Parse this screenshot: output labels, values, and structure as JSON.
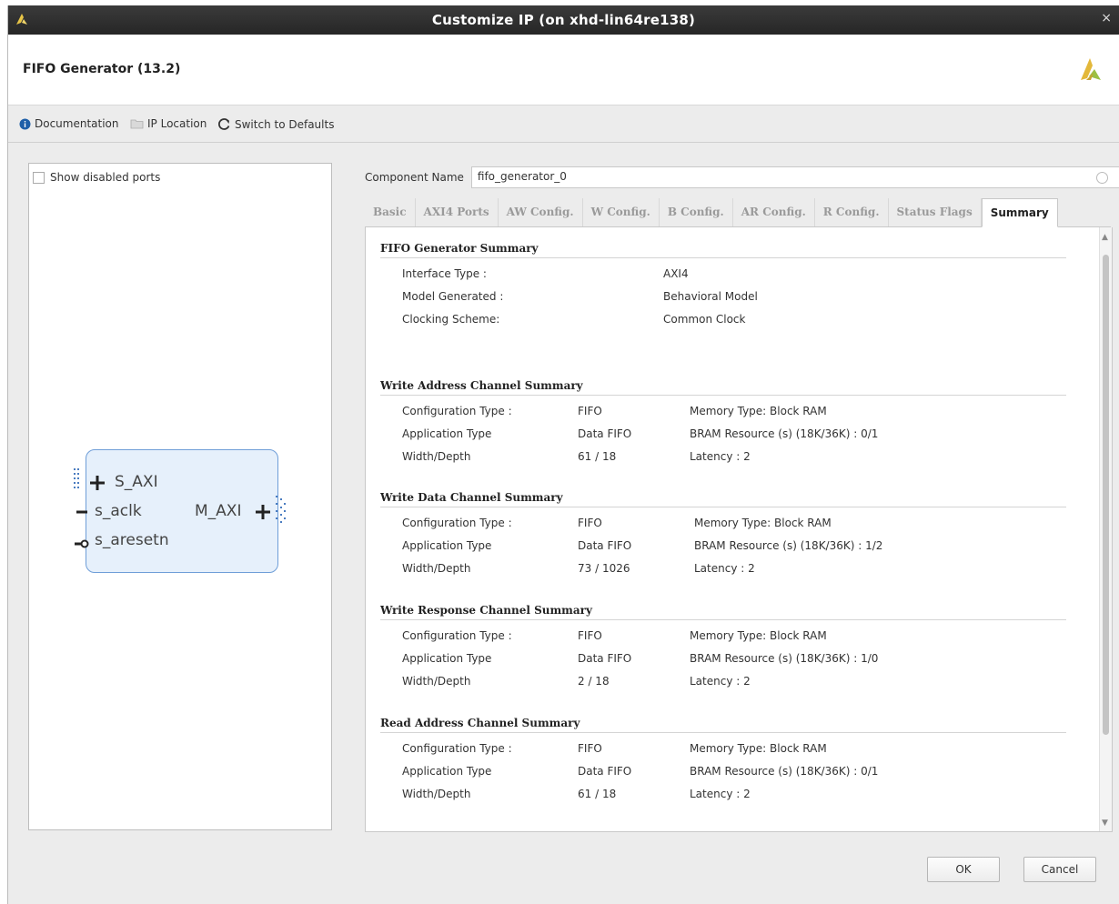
{
  "window": {
    "title": "Customize IP (on xhd-lin64re138)",
    "close_glyph": "×"
  },
  "header": {
    "ip_title": "FIFO Generator (13.2)"
  },
  "toolbar": {
    "documentation": "Documentation",
    "ip_location": "IP Location",
    "switch_defaults": "Switch to Defaults"
  },
  "left_panel": {
    "show_disabled_ports": "Show disabled ports",
    "symbol": {
      "ports_left": [
        "S_AXI",
        "s_aclk",
        "s_aresetn"
      ],
      "ports_right": [
        "M_AXI"
      ]
    }
  },
  "component": {
    "label": "Component Name",
    "value": "fifo_generator_0"
  },
  "tabs": [
    {
      "label": "Basic",
      "active": false
    },
    {
      "label": "AXI4 Ports",
      "active": false
    },
    {
      "label": "AW Config.",
      "active": false
    },
    {
      "label": "W Config.",
      "active": false
    },
    {
      "label": "B Config.",
      "active": false
    },
    {
      "label": "AR Config.",
      "active": false
    },
    {
      "label": "R Config.",
      "active": false
    },
    {
      "label": "Status Flags",
      "active": false
    },
    {
      "label": "Summary",
      "active": true
    }
  ],
  "summary": {
    "fifo_generator": {
      "title": "FIFO Generator Summary",
      "rows": [
        {
          "label": "Interface Type :",
          "value": "AXI4"
        },
        {
          "label": "Model Generated :",
          "value": "Behavioral Model"
        },
        {
          "label": "Clocking Scheme:",
          "value": "Common Clock"
        }
      ]
    },
    "channels": [
      {
        "title": "Write Address Channel Summary",
        "rows": [
          {
            "label": "Configuration Type :",
            "value": "FIFO",
            "info": "Memory Type: Block RAM"
          },
          {
            "label": "Application Type",
            "value": "Data FIFO",
            "info": "BRAM Resource (s) (18K/36K) : 0/1"
          },
          {
            "label": "Width/Depth",
            "value": "61 / 18",
            "info": "Latency : 2"
          }
        ]
      },
      {
        "title": "Write Data Channel Summary",
        "rows": [
          {
            "label": "Configuration Type :",
            "value": "FIFO",
            "info": "Memory Type: Block RAM"
          },
          {
            "label": "Application Type",
            "value": "Data FIFO",
            "info": "BRAM Resource (s) (18K/36K) : 1/2"
          },
          {
            "label": "Width/Depth",
            "value": "73 / 1026",
            "info": "Latency : 2"
          }
        ]
      },
      {
        "title": "Write Response Channel Summary",
        "rows": [
          {
            "label": "Configuration Type :",
            "value": "FIFO",
            "info": "Memory Type: Block RAM"
          },
          {
            "label": "Application Type",
            "value": "Data FIFO",
            "info": "BRAM Resource (s) (18K/36K) : 1/0"
          },
          {
            "label": "Width/Depth",
            "value": "2 / 18",
            "info": "Latency : 2"
          }
        ]
      },
      {
        "title": "Read Address Channel Summary",
        "rows": [
          {
            "label": "Configuration Type :",
            "value": "FIFO",
            "info": "Memory Type: Block RAM"
          },
          {
            "label": "Application Type",
            "value": "Data FIFO",
            "info": "BRAM Resource (s) (18K/36K) : 0/1"
          },
          {
            "label": "Width/Depth",
            "value": "61 / 18",
            "info": "Latency : 2"
          }
        ]
      }
    ]
  },
  "buttons": {
    "ok": "OK",
    "cancel": "Cancel"
  },
  "colors": {
    "accent": "#1e5fa8",
    "symbol_fill": "#e6f0fb",
    "symbol_border": "#6f9ed8",
    "title_bar": "#2e2e2e"
  }
}
